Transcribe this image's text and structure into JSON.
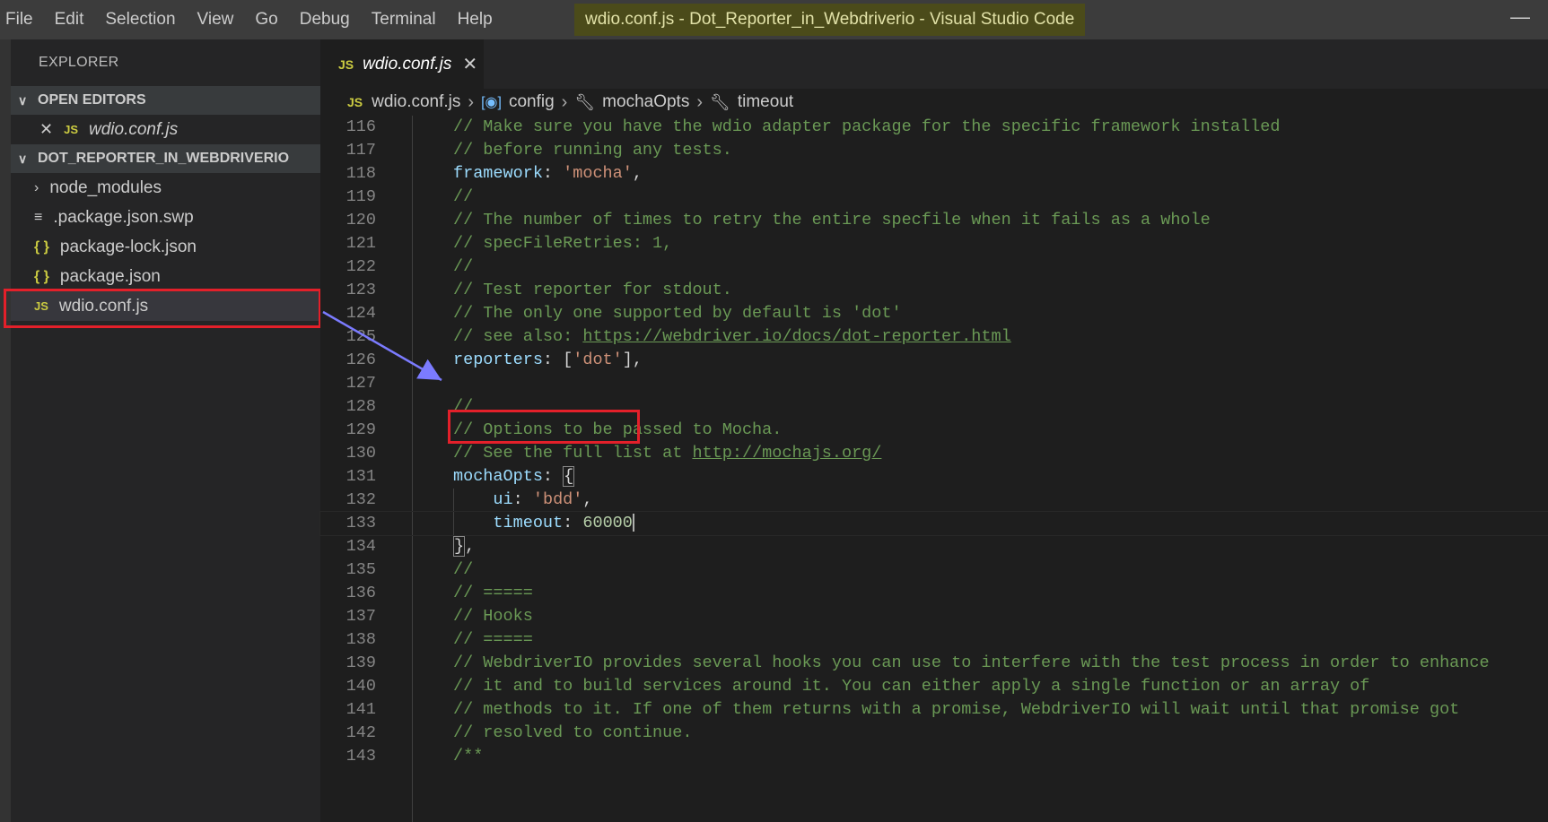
{
  "menu": [
    "File",
    "Edit",
    "Selection",
    "View",
    "Go",
    "Debug",
    "Terminal",
    "Help"
  ],
  "window_title": "wdio.conf.js - Dot_Reporter_in_Webdriverio - Visual Studio Code",
  "window_minimize": "—",
  "sidebar": {
    "title": "EXPLORER",
    "open_editors": {
      "label": "OPEN EDITORS",
      "items": [
        {
          "icon": "JS",
          "name": "wdio.conf.js"
        }
      ]
    },
    "project": {
      "label": "DOT_REPORTER_IN_WEBDRIVERIO",
      "items": [
        {
          "icon": "chevron-right-icon",
          "glyph": "›",
          "name": "node_modules"
        },
        {
          "icon": "lines-file-icon",
          "glyph": "≡",
          "name": ".package.json.swp"
        },
        {
          "icon": "json-icon",
          "glyph": "{ }",
          "name": "package-lock.json"
        },
        {
          "icon": "json-icon",
          "glyph": "{ }",
          "name": "package.json"
        },
        {
          "icon": "js-icon",
          "glyph": "JS",
          "name": "wdio.conf.js"
        }
      ]
    }
  },
  "tab": {
    "icon": "JS",
    "label": "wdio.conf.js",
    "close": "✕"
  },
  "breadcrumb": {
    "file_icon": "JS",
    "file": "wdio.conf.js",
    "items": [
      "config",
      "mochaOpts",
      "timeout"
    ]
  },
  "editor": {
    "lines": [
      {
        "n": "116",
        "t": "// Make sure you have the wdio adapter package for the specific framework installed"
      },
      {
        "n": "117",
        "t": "// before running any tests."
      },
      {
        "n": "118",
        "t": "framework: 'mocha',"
      },
      {
        "n": "119",
        "t": "//"
      },
      {
        "n": "120",
        "t": "// The number of times to retry the entire specfile when it fails as a whole"
      },
      {
        "n": "121",
        "t": "// specFileRetries: 1,"
      },
      {
        "n": "122",
        "t": "//"
      },
      {
        "n": "123",
        "t": "// Test reporter for stdout."
      },
      {
        "n": "124",
        "t": "// The only one supported by default is 'dot'"
      },
      {
        "n": "125",
        "t": "// see also: https://webdriver.io/docs/dot-reporter.html"
      },
      {
        "n": "126",
        "t": "reporters: ['dot'],"
      },
      {
        "n": "127",
        "t": ""
      },
      {
        "n": "128",
        "t": "//"
      },
      {
        "n": "129",
        "t": "// Options to be passed to Mocha."
      },
      {
        "n": "130",
        "t": "// See the full list at http://mochajs.org/"
      },
      {
        "n": "131",
        "t": "mochaOpts: {"
      },
      {
        "n": "132",
        "t": "    ui: 'bdd',"
      },
      {
        "n": "133",
        "t": "    timeout: 60000"
      },
      {
        "n": "134",
        "t": "},"
      },
      {
        "n": "135",
        "t": "//"
      },
      {
        "n": "136",
        "t": "// ====="
      },
      {
        "n": "137",
        "t": "// Hooks"
      },
      {
        "n": "138",
        "t": "// ====="
      },
      {
        "n": "139",
        "t": "// WebdriverIO provides several hooks you can use to interfere with the test process in order to enhance"
      },
      {
        "n": "140",
        "t": "// it and to build services around it. You can either apply a single function or an array of"
      },
      {
        "n": "141",
        "t": "// methods to it. If one of them returns with a promise, WebdriverIO will wait until that promise got"
      },
      {
        "n": "142",
        "t": "// resolved to continue."
      },
      {
        "n": "143",
        "t": "/**"
      }
    ]
  },
  "colors": {
    "titlebar": "#3c3c3c",
    "sidebar": "#252526",
    "editor": "#1e1e1e",
    "comment": "#6a9955",
    "property": "#9cdcfe",
    "string": "#ce9178",
    "number": "#b5cea8",
    "highlight_box": "#e3202a",
    "arrow": "#7b7bff"
  }
}
